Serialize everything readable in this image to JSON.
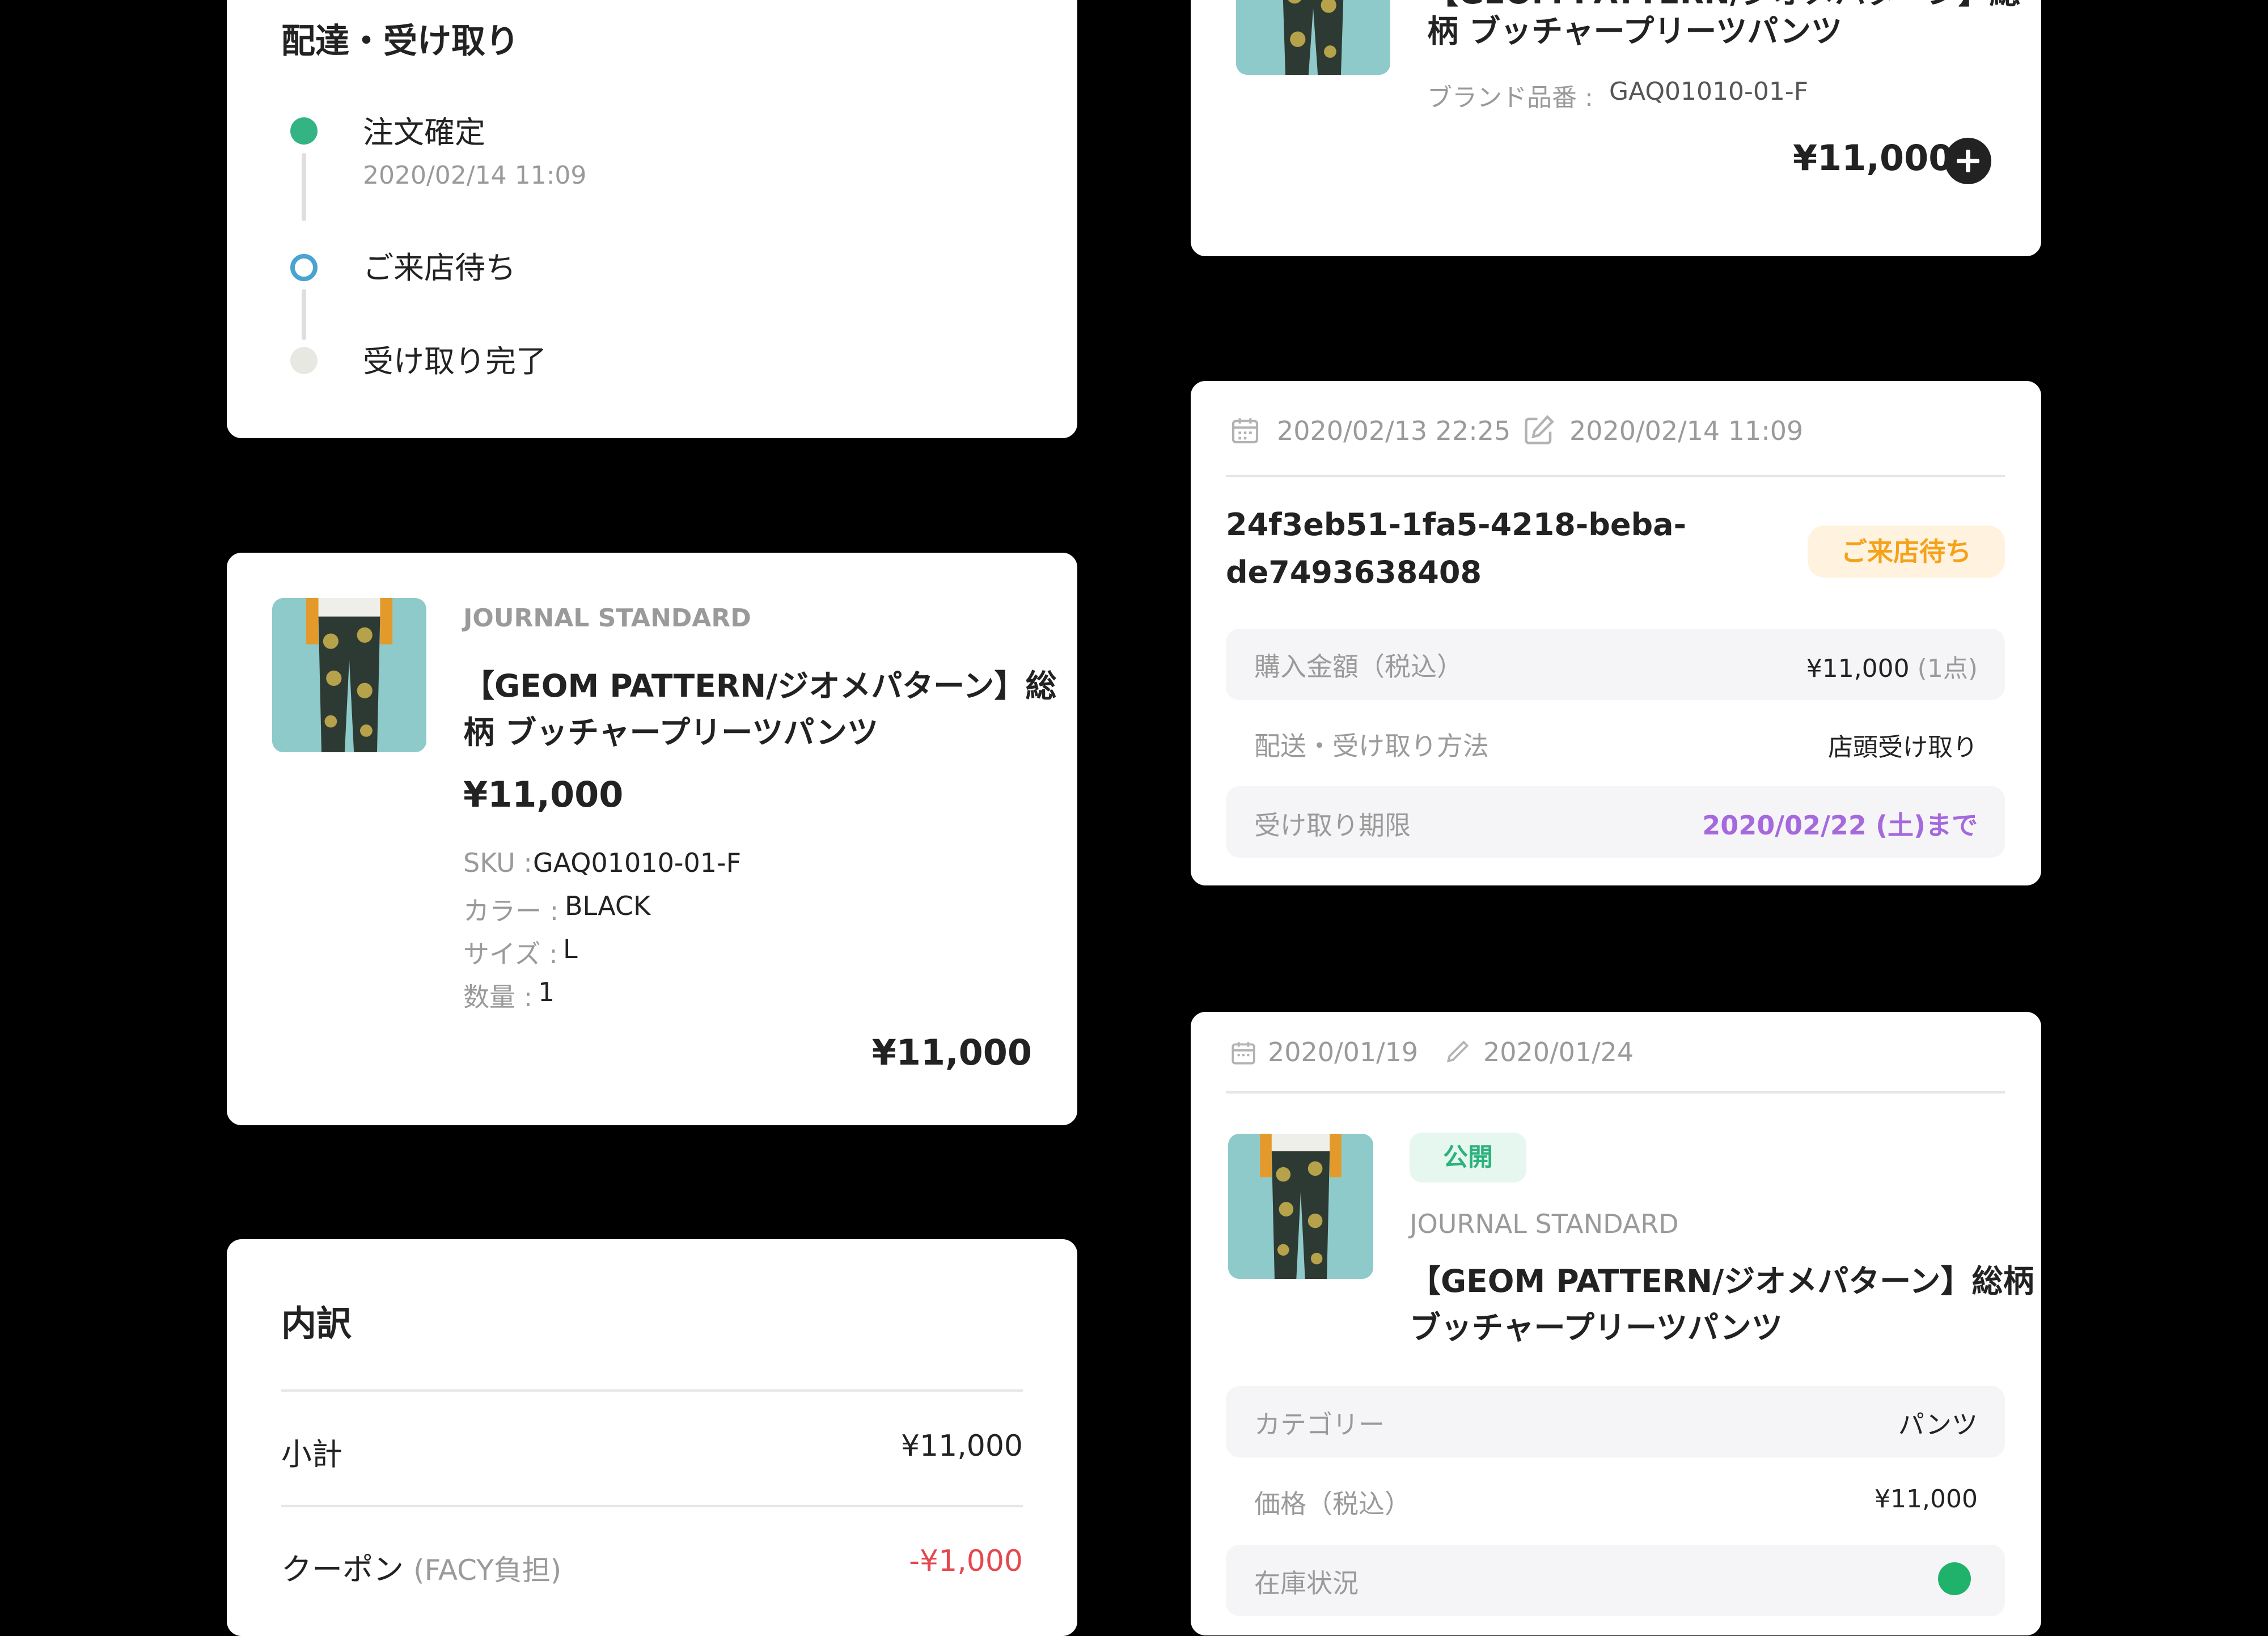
{
  "delivery": {
    "title": "配達・受け取り",
    "steps": [
      {
        "label": "注文確定",
        "time": "2020/02/14 11:09"
      },
      {
        "label": "ご来店待ち"
      },
      {
        "label": "受け取り完了"
      }
    ]
  },
  "product": {
    "brand": "JOURNAL STANDARD",
    "name_line1": "【GEOM PATTERN/ジオメパターン】総",
    "name_line2": "柄 ブッチャープリーツパンツ",
    "price": "¥11,000",
    "specs": [
      {
        "key": "SKU :",
        "value": "GAQ01010-01-F"
      },
      {
        "key": "カラー :",
        "value": "BLACK"
      },
      {
        "key": "サイズ :",
        "value": "L"
      },
      {
        "key": "数量 :",
        "value": "1"
      }
    ],
    "total": "¥11,000"
  },
  "breakdown": {
    "title": "内訳",
    "subtotal_label": "小計",
    "subtotal_value": "¥11,000",
    "coupon_label": "クーポン",
    "coupon_note": "(FACY負担)",
    "coupon_value": "-¥1,000"
  },
  "top_right": {
    "name_line1": "【GEOM PATTERN/ジオメパターン】総",
    "name_line2": "柄 ブッチャープリーツパンツ",
    "brand_code_label": "ブランド品番 :",
    "brand_code": "GAQ01010-01-F",
    "price": "¥11,000"
  },
  "order": {
    "created": "2020/02/13 22:25",
    "updated": "2020/02/14 11:09",
    "id_line1": "24f3eb51-1fa5-4218-beba-",
    "id_line2": "de7493638408",
    "status": "ご来店待ち",
    "rows": [
      {
        "label": "購入金額（税込）",
        "value": "¥11,000",
        "note": "(1点)"
      },
      {
        "label": "配送・受け取り方法",
        "value": "店頭受け取り"
      },
      {
        "label": "受け取り期限",
        "value": "2020/02/22 (土)まで"
      }
    ]
  },
  "listing": {
    "created": "2020/01/19",
    "updated": "2020/01/24",
    "status": "公開",
    "brand": "JOURNAL STANDARD",
    "name_line1": "【GEOM PATTERN/ジオメパターン】総柄",
    "name_line2": "ブッチャープリーツパンツ",
    "rows": [
      {
        "label": "カテゴリー",
        "value": "パンツ"
      },
      {
        "label": "価格（税込）",
        "value": "¥11,000"
      },
      {
        "label": "在庫状況"
      }
    ]
  },
  "colors": {
    "done": "#34b483",
    "current": "#4aa3d1",
    "pending": "#e8e8e3",
    "status_orange": "#f5a21b",
    "deadline_purple": "#a569dd",
    "negative_red": "#e5484d",
    "stock_green": "#1fb26b"
  },
  "icons": {
    "created": "calendar-icon",
    "updated": "edit-icon",
    "add": "plus-circle-icon"
  }
}
